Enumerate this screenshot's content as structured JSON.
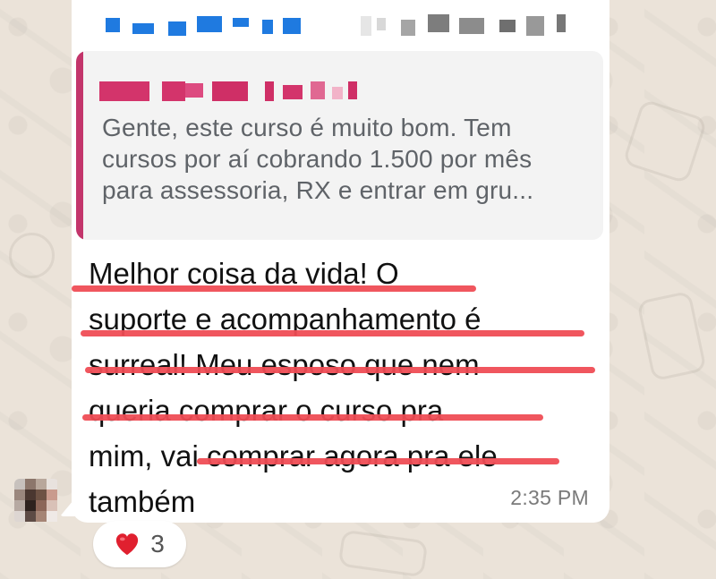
{
  "quoted_message": {
    "lines": [
      "Gente, este curso é muito bom. Tem",
      "cursos por aí cobrando 1.500 por mês",
      "para assessoria, RX e entrar em gru..."
    ]
  },
  "message": {
    "lines": [
      "Melhor coisa  da vida! O",
      "suporte e acompanhamento é",
      "surreal! Meu esposo que nem",
      "queria comprar o curso pra",
      "mim, vai comprar agora pra ele",
      "também"
    ],
    "time": "2:35 PM"
  },
  "reaction": {
    "emoji_icon": "heart-icon",
    "count": "3"
  },
  "colors": {
    "quote_bar": "#c3356b",
    "sender_name": "#1f7ae0",
    "underline": "#ef4d55",
    "bubble": "#ffffff",
    "wallpaper": "#ebe3d9"
  }
}
